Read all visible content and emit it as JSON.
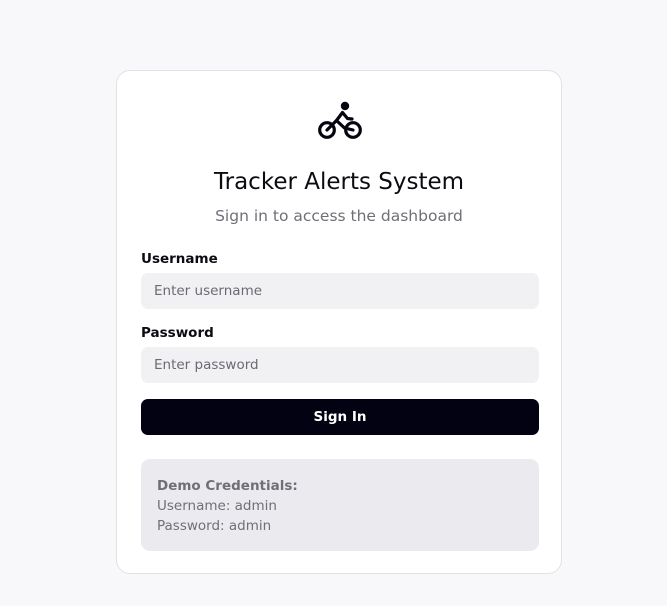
{
  "app": {
    "title": "Tracker Alerts System",
    "subtitle": "Sign in to access the dashboard",
    "logo_icon": "bike-rider-icon"
  },
  "form": {
    "username_label": "Username",
    "username_placeholder": "Enter username",
    "username_value": "",
    "password_label": "Password",
    "password_placeholder": "Enter password",
    "password_value": "",
    "submit_label": "Sign In"
  },
  "demo": {
    "title": "Demo Credentials:",
    "username_line": "Username: admin",
    "password_line": "Password: admin"
  },
  "colors": {
    "page_background": "#f8f8fa",
    "card_background": "#ffffff",
    "input_background": "#f1f1f4",
    "button_background": "#030212",
    "demo_background": "#ebeaee",
    "muted_text": "#6f6f78"
  }
}
